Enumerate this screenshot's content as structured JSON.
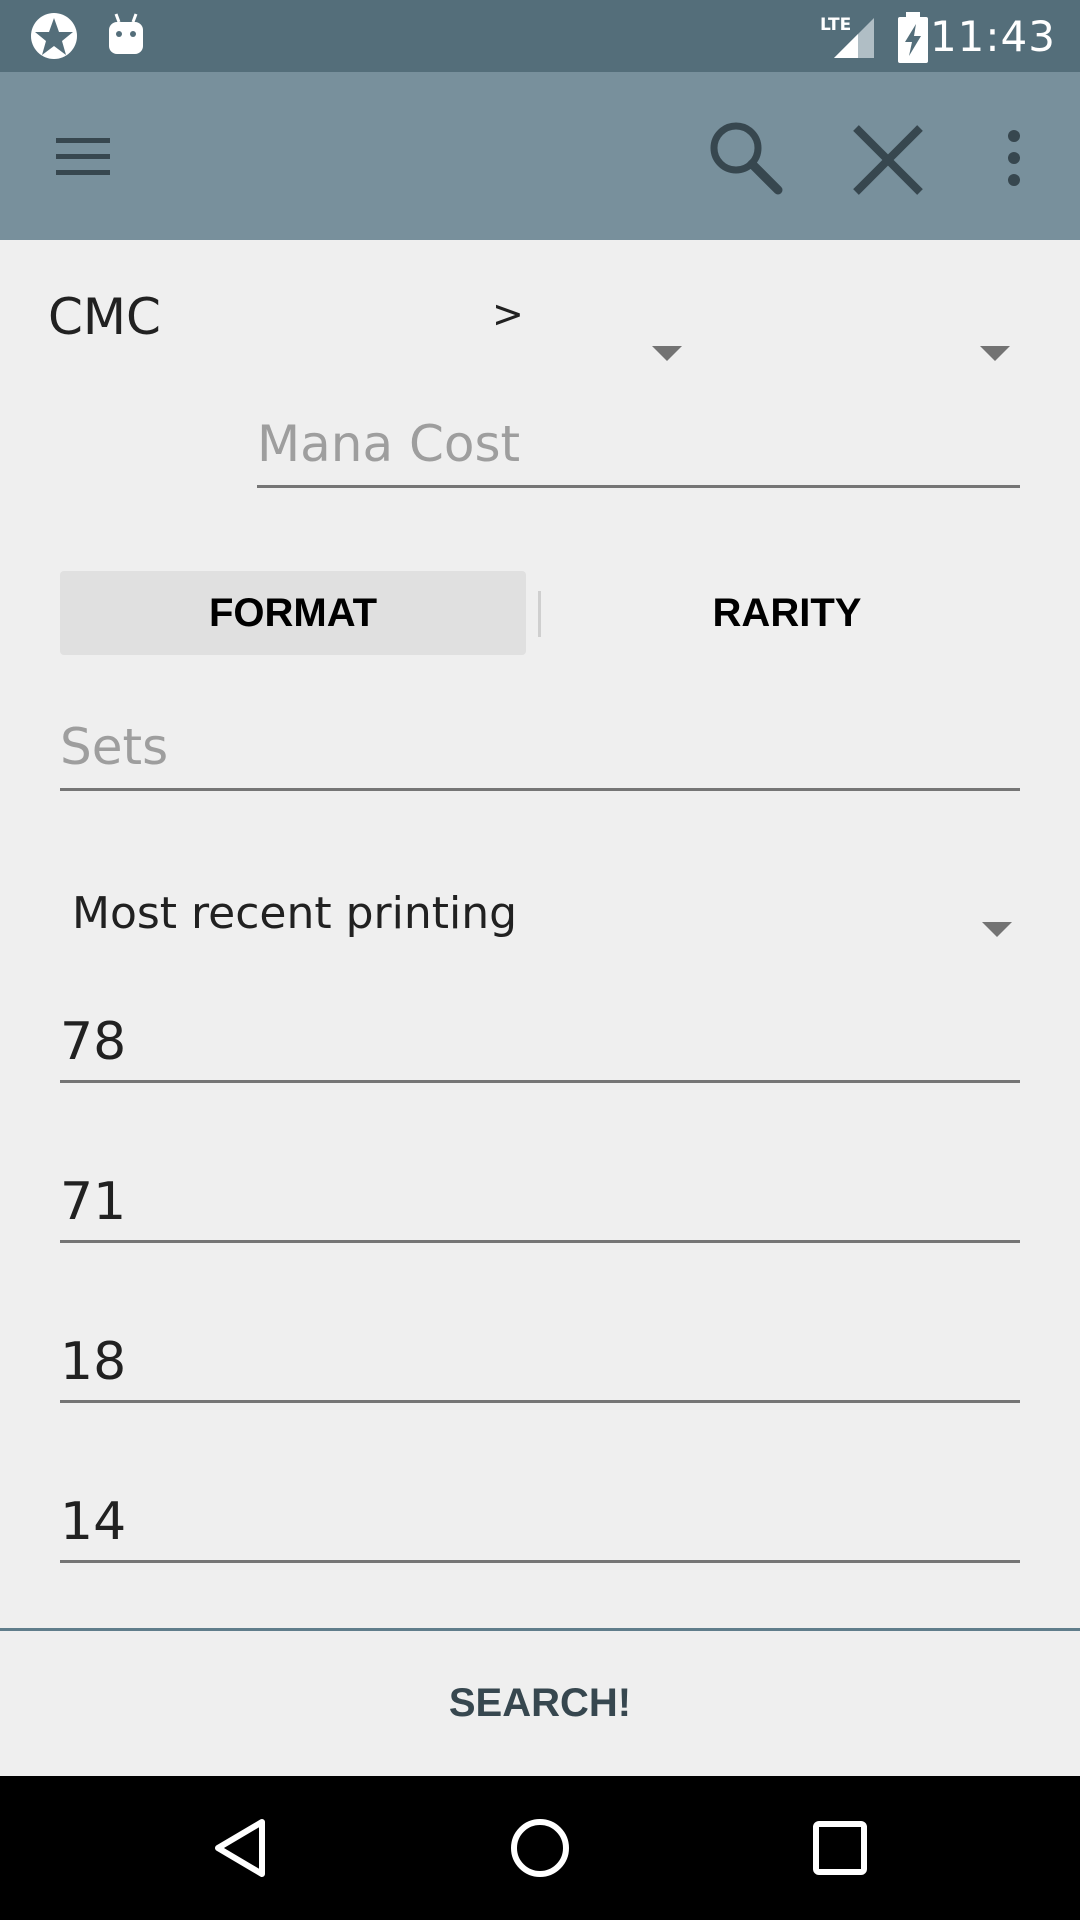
{
  "status_bar": {
    "time": "11:43",
    "network": "LTE",
    "icons": [
      "app-notification-icon",
      "android-debug-icon",
      "lte-signal-icon",
      "battery-charging-icon"
    ]
  },
  "app_bar": {
    "icons": [
      "menu-icon",
      "search-icon",
      "close-icon",
      "more-vert-icon"
    ]
  },
  "filters": {
    "cmc_label": "CMC",
    "cmc_operator": ">",
    "cmc_value": "",
    "mana_cost_color": "",
    "mana_cost_placeholder": "Mana Cost",
    "format_label": "FORMAT",
    "rarity_label": "RARITY",
    "sets_placeholder": "Sets",
    "printing_option": "Most recent printing",
    "fields": [
      {
        "value": "78"
      },
      {
        "value": "71"
      },
      {
        "value": "18"
      },
      {
        "value": "14"
      }
    ]
  },
  "search_button": "SEARCH!",
  "nav_bar": {
    "icons": [
      "back-icon",
      "home-icon",
      "recents-icon"
    ]
  },
  "colors": {
    "status_bar": "#546e7a",
    "app_bar": "#78909c",
    "background": "#efefef",
    "search_text": "#37474f"
  }
}
